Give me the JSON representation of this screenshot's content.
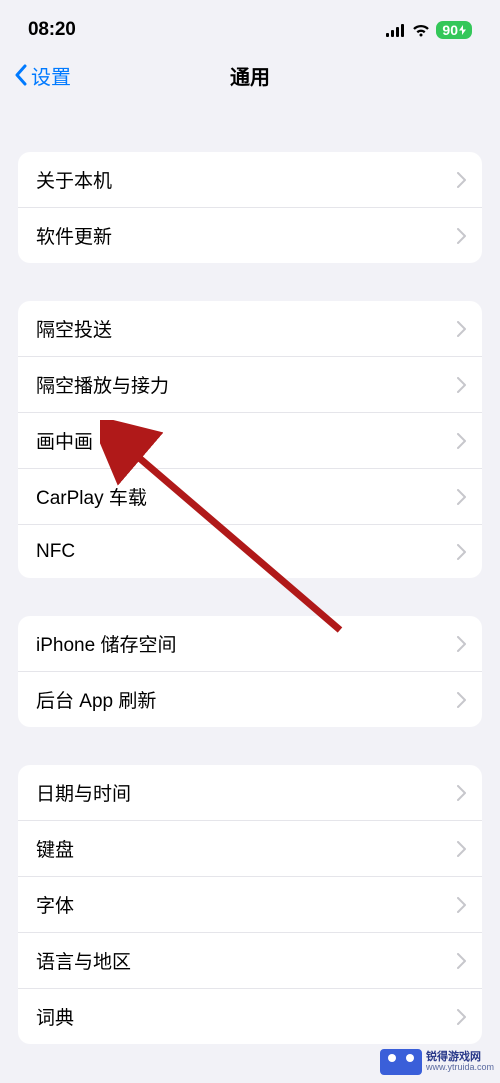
{
  "status": {
    "time": "08:20",
    "battery": "90"
  },
  "nav": {
    "back": "设置",
    "title": "通用"
  },
  "groups": [
    {
      "items": [
        {
          "label": "关于本机"
        },
        {
          "label": "软件更新"
        }
      ]
    },
    {
      "items": [
        {
          "label": "隔空投送"
        },
        {
          "label": "隔空播放与接力"
        },
        {
          "label": "画中画"
        },
        {
          "label": "CarPlay 车载"
        },
        {
          "label": "NFC"
        }
      ]
    },
    {
      "items": [
        {
          "label": "iPhone 储存空间"
        },
        {
          "label": "后台 App 刷新"
        }
      ]
    },
    {
      "items": [
        {
          "label": "日期与时间"
        },
        {
          "label": "键盘"
        },
        {
          "label": "字体"
        },
        {
          "label": "语言与地区"
        },
        {
          "label": "词典"
        }
      ]
    }
  ],
  "watermark": {
    "name": "锐得游戏网",
    "url": "www.ytruida.com"
  }
}
